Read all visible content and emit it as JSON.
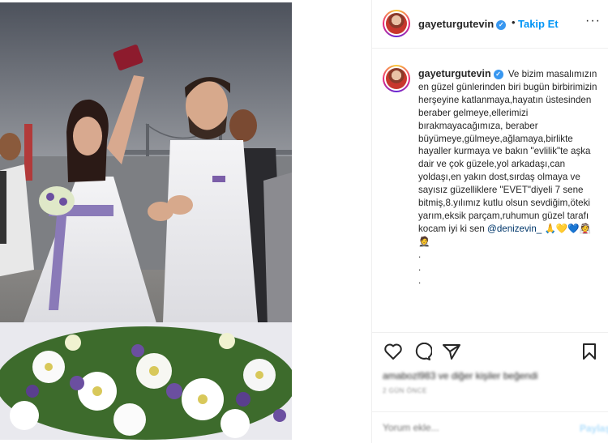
{
  "post": {
    "username": "gayeturgutevin",
    "follow_label": "Takip Et",
    "dot_separator": "•",
    "more_label": "···",
    "caption": {
      "username": "gayeturgutevin",
      "text": "Ve bizim masalımızın en güzel günlerinden biri bugün birbirimizin herşeyine katlanmaya,hayatın üstesinden beraber gelmeye,ellerimizi bırakmayacağımıza, beraber büyümeye,gülmeye,ağlamaya,birlikte hayaller kurmaya ve bakın \"evlilik\"te aşka dair ve çok güzele,yol arkadaşı,can yoldaşı,en yakın dost,sırdaş olmaya ve sayısız güzelliklere \"EVET\"diyeli 7 sene bitmiş,8.yılımız kutlu olsun sevdiğim,öteki yarım,eksik parçam,ruhumun güzel tarafı kocam iyi ki sen ",
      "mention": "@denizevin_",
      "emojis": "🙏💛💙👰🤵",
      "trailing_dots": [
        ".",
        ".",
        "."
      ]
    },
    "likes_text": "amabozl983 ve diğer kişiler beğendi",
    "time_ago": "2 GÜN ÖNCE",
    "comment_placeholder": "Yorum ekle...",
    "post_button": "Paylaş",
    "icons": [
      "heart-icon",
      "comment-icon",
      "share-icon",
      "bookmark-icon"
    ],
    "colors": {
      "link_blue": "#0095f6",
      "verified": "#3897f0",
      "mention": "#00376b",
      "border": "#efefef"
    }
  }
}
